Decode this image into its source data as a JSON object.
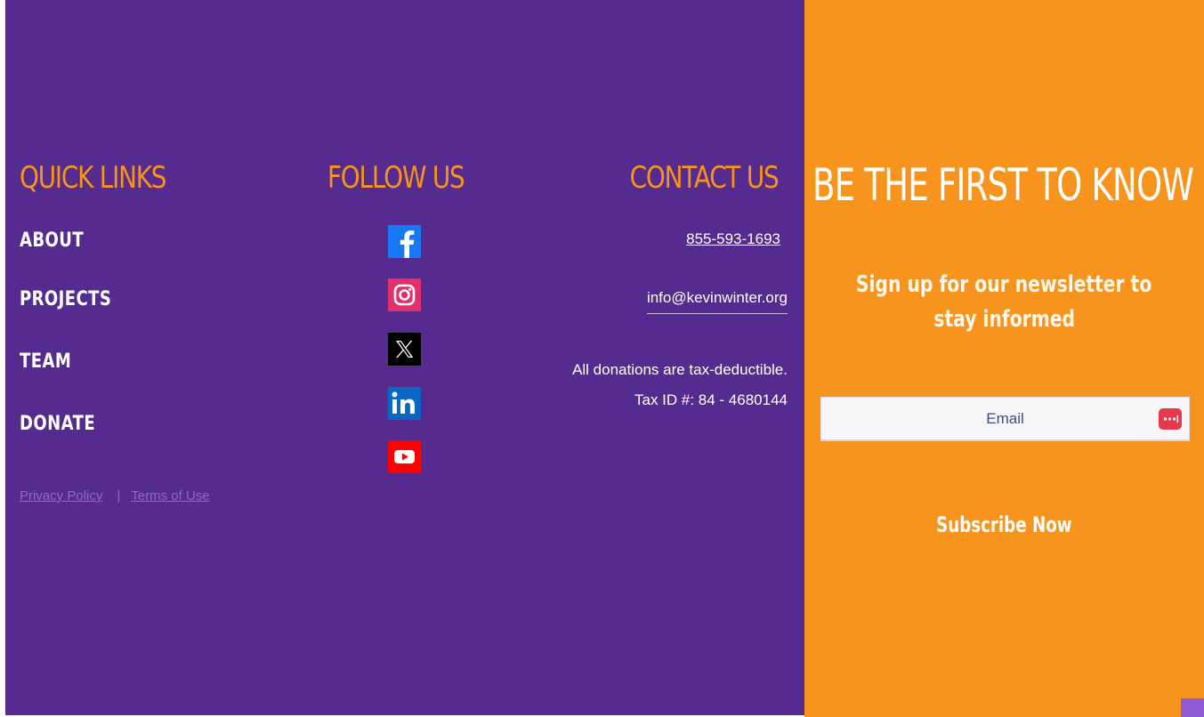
{
  "colors": {
    "left_background": "#552b8f",
    "right_background": "#f6941d",
    "heading_accent": "#f6941d",
    "legal_link": "#8b6cc4"
  },
  "quick_links": {
    "heading": "QUICK LINKS",
    "items": [
      {
        "label": "ABOUT"
      },
      {
        "label": "PROJECTS"
      },
      {
        "label": "TEAM"
      },
      {
        "label": "DONATE"
      }
    ],
    "privacy_label": "Privacy Policy",
    "separator": "|",
    "terms_label": "Terms of Use"
  },
  "follow_us": {
    "heading": "FOLLOW US",
    "icons": [
      {
        "icon": "facebook-icon",
        "color": "#1877f2"
      },
      {
        "icon": "instagram-icon",
        "color": "#e1306c"
      },
      {
        "icon": "x-icon",
        "color": "#000000"
      },
      {
        "icon": "linkedin-icon",
        "color": "#0a66c2"
      },
      {
        "icon": "youtube-icon",
        "color": "#ff0000"
      }
    ]
  },
  "contact_us": {
    "heading": "CONTACT US",
    "phone": "855-593-1693",
    "email": "info@kevinwinter.org",
    "donation_note": "All donations are tax-deductible.",
    "tax_id": "Tax ID #: 84 - 4680144"
  },
  "newsletter": {
    "title": "BE THE FIRST TO KNOW",
    "subtitle_line1": "Sign up for our newsletter to",
    "subtitle_line2": "stay informed",
    "email_placeholder": "Email",
    "subscribe_label": "Subscribe Now"
  }
}
